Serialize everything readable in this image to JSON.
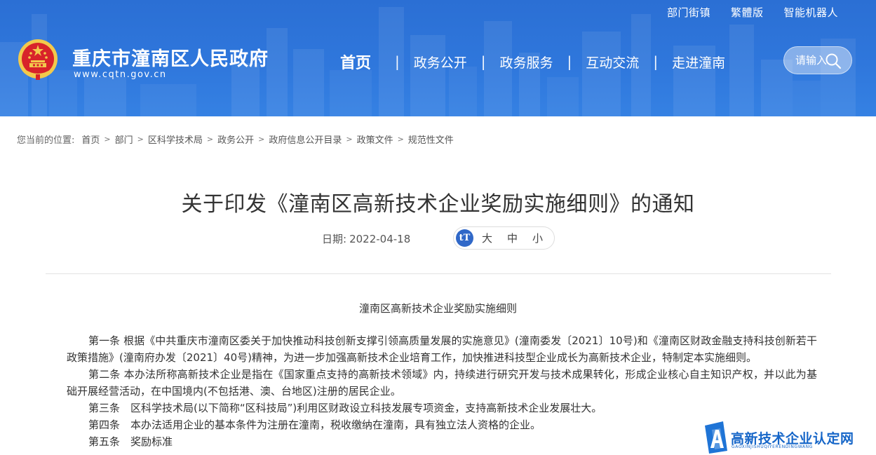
{
  "top_links": [
    "部门街镇",
    "繁體版",
    "智能机器人"
  ],
  "site": {
    "title": "重庆市潼南区人民政府",
    "url": "www.cqtn.gov.cn"
  },
  "nav": {
    "home": "首页",
    "items": [
      "政务公开",
      "政务服务",
      "互动交流",
      "走进潼南"
    ],
    "separator": "|"
  },
  "search": {
    "placeholder": "请输入"
  },
  "breadcrumb": {
    "prefix": "您当前的位置:",
    "items": [
      "首页",
      "部门",
      "区科学技术局",
      "政务公开",
      "政府信息公开目录",
      "政策文件",
      "规范性文件"
    ],
    "arrow": ">"
  },
  "article": {
    "title": "关于印发《潼南区高新技术企业奖励实施细则》的通知",
    "date_label": "日期:",
    "date": "2022-04-18",
    "font_size": {
      "icon": "tT",
      "large": "大",
      "medium": "中",
      "small": "小"
    },
    "doc_heading": "潼南区高新技术企业奖励实施细则",
    "paragraphs": [
      "第一条 根据《中共重庆市潼南区委关于加快推动科技创新支撑引领高质量发展的实施意见》(潼南委发〔2021〕10号)和《潼南区财政金融支持科技创新若干政策措施》(潼南府办发〔2021〕40号)精神，为进一步加强高新技术企业培育工作，加快推进科技型企业成长为高新技术企业，特制定本实施细则。",
      "第二条 本办法所称高新技术企业是指在《国家重点支持的高新技术领域》内，持续进行研究开发与技术成果转化，形成企业核心自主知识产权，并以此为基础开展经营活动，在中国境内(不包括港、澳、台地区)注册的居民企业。",
      "第三条　区科学技术局(以下简称“区科技局”)利用区财政设立科技发展专项资金，支持高新技术企业发展壮大。",
      "第四条　本办法适用企业的基本条件为注册在潼南，税收缴纳在潼南，具有独立法人资格的企业。",
      "第五条　奖励标准"
    ]
  },
  "watermark": {
    "text": "高新技术企业认定网",
    "subtext": "GAOXINJISHUQIYERENDINGWANG"
  },
  "colors": {
    "header_blue": "#2f77dc",
    "emblem_red": "#d8232a",
    "emblem_gold": "#f2c94c",
    "watermark_blue": "#1666c8"
  }
}
